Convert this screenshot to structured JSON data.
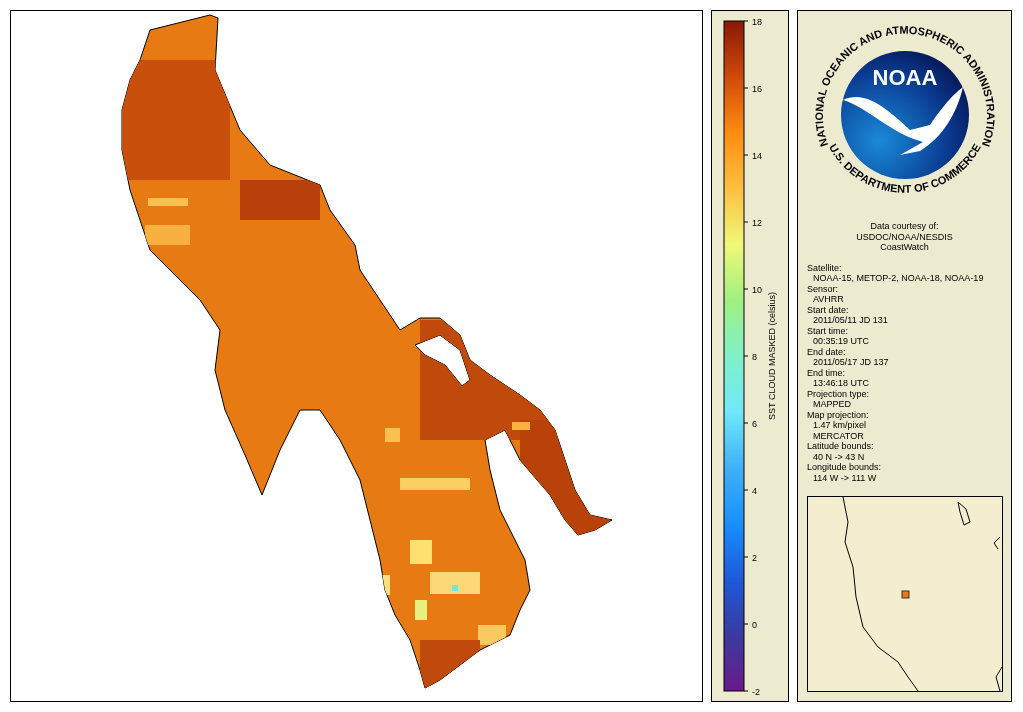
{
  "colorbar": {
    "title": "SST CLOUD MASKED (celsius)",
    "ticks": [
      "18",
      "16",
      "14",
      "12",
      "10",
      "8",
      "6",
      "4",
      "2",
      "0",
      "-2"
    ]
  },
  "logo": {
    "name": "NOAA",
    "ring_top": "NATIONAL OCEANIC AND ATMOSPHERIC ADMINISTRATION",
    "ring_bottom": "U.S. DEPARTMENT OF COMMERCE"
  },
  "credit": [
    "Data courtesy of:",
    "USDOC/NOAA/NESDIS",
    "CoastWatch"
  ],
  "fields": [
    {
      "label": "Satellite:",
      "values": [
        "NOAA-15, METOP-2, NOAA-18, NOAA-19"
      ]
    },
    {
      "label": "Sensor:",
      "values": [
        "AVHRR"
      ]
    },
    {
      "label": "Start date:",
      "values": [
        "2011/05/11 JD 131"
      ]
    },
    {
      "label": "Start time:",
      "values": [
        "00:35:19 UTC"
      ]
    },
    {
      "label": "End date:",
      "values": [
        "2011/05/17 JD 137"
      ]
    },
    {
      "label": "End time:",
      "values": [
        "13:46:18 UTC"
      ]
    },
    {
      "label": "Projection type:",
      "values": [
        "MAPPED"
      ]
    },
    {
      "label": "Map projection:",
      "values": [
        "1.47 km/pixel",
        "MERCATOR"
      ]
    },
    {
      "label": "Latitude bounds:",
      "values": [
        "40 N -> 43 N"
      ]
    },
    {
      "label": "Longitude bounds:",
      "values": [
        "114 W -> 111 W"
      ]
    }
  ]
}
